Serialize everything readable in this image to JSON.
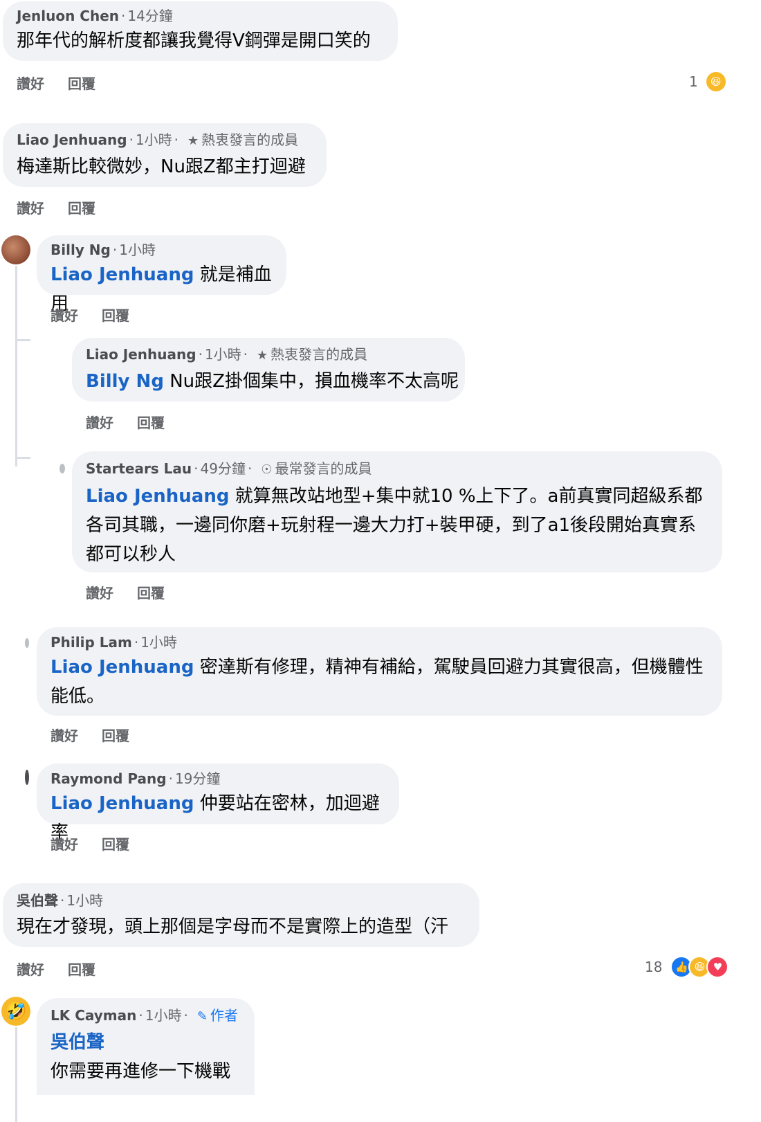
{
  "actions": {
    "like": "讚好",
    "reply": "回覆"
  },
  "comments": [
    {
      "name": "Jenluon Chen",
      "time": "14分鐘",
      "badge": "",
      "text": "那年代的解析度都讓我覺得V鋼彈是開口笑的",
      "reaction_count": "1"
    },
    {
      "name": "Liao Jenhuang",
      "time": "1小時",
      "badge": "熱衷發言的成員",
      "text": "梅達斯比較微妙，Nu跟Z都主打迴避"
    },
    {
      "name": "Billy Ng",
      "time": "1小時",
      "badge": "",
      "mention": "Liao Jenhuang",
      "text": " 就是補血用"
    },
    {
      "name": "Liao Jenhuang",
      "time": "1小時",
      "badge": "熱衷發言的成員",
      "mention": "Billy Ng",
      "text": " Nu跟Z掛個集中，損血機率不太高呢"
    },
    {
      "name": "Startears Lau",
      "time": "49分鐘",
      "badge": "最常發言的成員",
      "mention": "Liao Jenhuang",
      "text": " 就算無改站地型+集中就10 %上下了。a前真實同超級系都各司其職，一邊同你磨+玩射程一邊大力打+裝甲硬，到了a1後段開始真實系都可以秒人"
    },
    {
      "name": "Philip Lam",
      "time": "1小時",
      "badge": "",
      "mention": "Liao Jenhuang",
      "text": " 密達斯有修理，精神有補給，駕駛員回避力其實很高，但機體性能低。"
    },
    {
      "name": "Raymond Pang",
      "time": "19分鐘",
      "badge": "",
      "mention": "Liao Jenhuang",
      "text": " 仲要站在密林，加迴避率"
    },
    {
      "name": "吳伯聲",
      "time": "1小時",
      "badge": "",
      "text": "現在才發現，頭上那個是字母而不是實際上的造型（汗",
      "reaction_count": "18"
    },
    {
      "name": "LK Cayman",
      "time": "1小時",
      "badge": "作者",
      "mention": "吳伯聲",
      "text": "你需要再進修一下機戰"
    }
  ],
  "colors": {
    "bubble": "#f0f2f5",
    "mention": "#1a64c6",
    "meta": "#65676b",
    "like_blue": "#1877f2",
    "haha_yellow": "#f7b928",
    "love_red": "#f33e58"
  },
  "icons": {
    "star_badge": "star-icon",
    "rising_badge": "medal-icon",
    "author_badge": "pencil-icon"
  }
}
